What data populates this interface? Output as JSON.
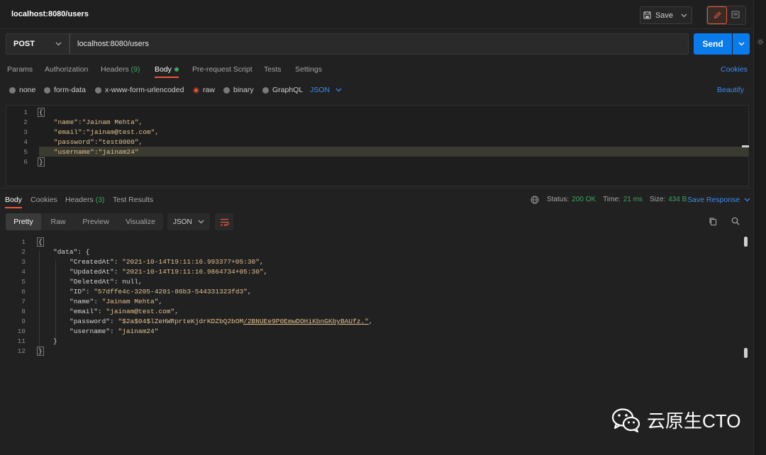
{
  "header": {
    "title": "localhost:8080/users",
    "save_label": "Save"
  },
  "request": {
    "method": "POST",
    "url": "localhost:8080/users",
    "send_label": "Send",
    "tabs": [
      {
        "label": "Params"
      },
      {
        "label": "Authorization"
      },
      {
        "label": "Headers",
        "count": "(9)"
      },
      {
        "label": "Body",
        "active": true
      },
      {
        "label": "Pre-request Script"
      },
      {
        "label": "Tests"
      },
      {
        "label": "Settings"
      }
    ],
    "cookies_label": "Cookies",
    "body_types": [
      "none",
      "form-data",
      "x-www-form-urlencoded",
      "raw",
      "binary",
      "GraphQL"
    ],
    "selected_body_type": "raw",
    "format": "JSON",
    "beautify_label": "Beautify",
    "body_lines": [
      "{",
      "    \"name\":\"Jainam Mehta\",",
      "    \"email\":\"jainam@test.com\",",
      "    \"password\":\"test0000\",",
      "    \"username\":\"jainam24\"",
      "}"
    ],
    "line_numbers": [
      "1",
      "2",
      "3",
      "4",
      "5",
      "6"
    ]
  },
  "response": {
    "tabs": [
      {
        "label": "Body",
        "active": true
      },
      {
        "label": "Cookies"
      },
      {
        "label": "Headers",
        "count": "(3)"
      },
      {
        "label": "Test Results"
      }
    ],
    "status_label": "Status:",
    "status_value": "200 OK",
    "time_label": "Time:",
    "time_value": "21 ms",
    "size_label": "Size:",
    "size_value": "434 B",
    "save_response_label": "Save Response",
    "view_modes": [
      "Pretty",
      "Raw",
      "Preview",
      "Visualize"
    ],
    "format": "JSON",
    "line_numbers": [
      "1",
      "2",
      "3",
      "4",
      "5",
      "6",
      "7",
      "8",
      "9",
      "10",
      "11",
      "12"
    ],
    "body": {
      "l1": "{",
      "l2_key": "\"data\"",
      "l2_rest": ": {",
      "fields": [
        {
          "key": "\"CreatedAt\"",
          "value": "\"2021-10-14T19:11:16.993377+05:30\"",
          "sep": ","
        },
        {
          "key": "\"UpdatedAt\"",
          "value": "\"2021-10-14T19:11:16.9864734+05:30\"",
          "sep": ","
        },
        {
          "key": "\"DeletedAt\"",
          "value": "null",
          "sep": ","
        },
        {
          "key": "\"ID\"",
          "value": "\"57dffe4c-3205-4201-86b3-544331323fd3\"",
          "sep": ","
        },
        {
          "key": "\"name\"",
          "value": "\"Jainam Mehta\"",
          "sep": ","
        },
        {
          "key": "\"email\"",
          "value": "\"jainam@test.com\"",
          "sep": ","
        },
        {
          "key": "\"password\"",
          "value_a": "\"$2a$04$lZeHWRprteKjdrKDZbQ2bOM",
          "value_b": "/2BNUEe9P0EmwDOHiKbnGKbyBAUfz.\"",
          "sep": ","
        },
        {
          "key": "\"username\"",
          "value": "\"jainam24\"",
          "sep": ""
        }
      ],
      "l11": "}",
      "l12": "}"
    }
  },
  "watermark": {
    "text": "云原生CTO"
  },
  "colors": {
    "accent": "#e9583b",
    "primary": "#097bed",
    "link": "#3d8bf2",
    "success": "#3ba55c"
  }
}
